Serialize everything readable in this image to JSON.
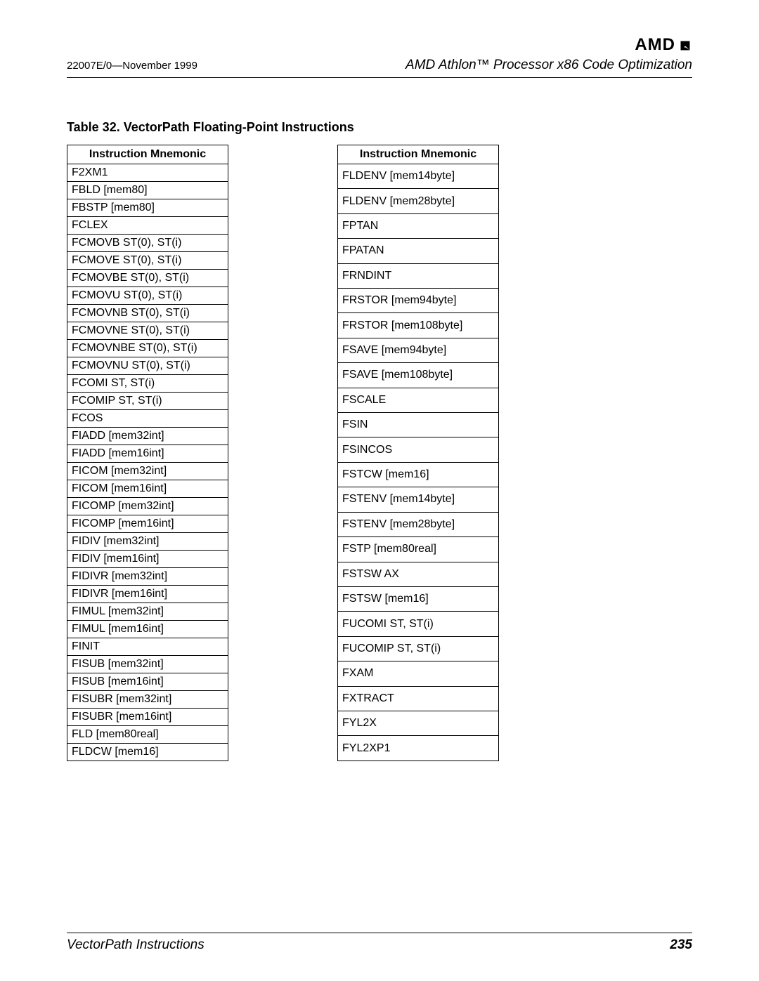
{
  "header": {
    "logo_text": "AMD",
    "doc_code": "22007E/0—November 1999",
    "doc_title": "AMD Athlon™ Processor x86 Code Optimization"
  },
  "table_caption": "Table 32. VectorPath Floating-Point Instructions",
  "column_header": "Instruction Mnemonic",
  "left_table": [
    "F2XM1",
    "FBLD [mem80]",
    "FBSTP [mem80]",
    "FCLEX",
    "FCMOVB ST(0), ST(i)",
    "FCMOVE ST(0), ST(i)",
    "FCMOVBE ST(0), ST(i)",
    "FCMOVU ST(0), ST(i)",
    "FCMOVNB ST(0), ST(i)",
    "FCMOVNE ST(0), ST(i)",
    "FCMOVNBE ST(0), ST(i)",
    "FCMOVNU ST(0), ST(i)",
    "FCOMI ST, ST(i)",
    "FCOMIP ST, ST(i)",
    "FCOS",
    "FIADD [mem32int]",
    "FIADD [mem16int]",
    "FICOM [mem32int]",
    "FICOM [mem16int]",
    "FICOMP [mem32int]",
    "FICOMP [mem16int]",
    "FIDIV [mem32int]",
    "FIDIV [mem16int]",
    "FIDIVR [mem32int]",
    "FIDIVR [mem16int]",
    "FIMUL [mem32int]",
    "FIMUL [mem16int]",
    "FINIT",
    "FISUB [mem32int]",
    "FISUB [mem16int]",
    "FISUBR [mem32int]",
    "FISUBR [mem16int]",
    "FLD [mem80real]",
    "FLDCW [mem16]"
  ],
  "right_table": [
    "FLDENV [mem14byte]",
    "FLDENV [mem28byte]",
    "FPTAN",
    "FPATAN",
    "FRNDINT",
    "FRSTOR [mem94byte]",
    "FRSTOR [mem108byte]",
    "FSAVE [mem94byte]",
    "FSAVE [mem108byte]",
    "FSCALE",
    "FSIN",
    "FSINCOS",
    "FSTCW [mem16]",
    "FSTENV [mem14byte]",
    "FSTENV [mem28byte]",
    "FSTP [mem80real]",
    "FSTSW AX",
    "FSTSW [mem16]",
    "FUCOMI ST, ST(i)",
    "FUCOMIP ST, ST(i)",
    "FXAM",
    "FXTRACT",
    "FYL2X",
    "FYL2XP1"
  ],
  "footer": {
    "section": "VectorPath Instructions",
    "page_number": "235"
  }
}
